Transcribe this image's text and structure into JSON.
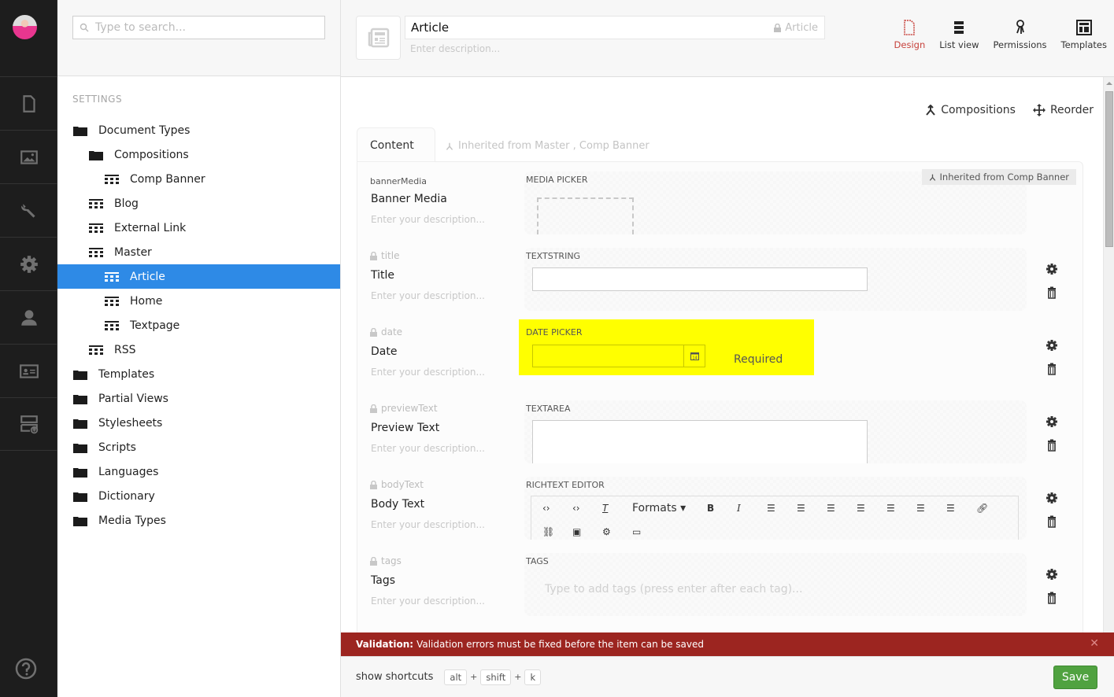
{
  "nav": {
    "sections": [
      "content",
      "media",
      "settings",
      "developer",
      "users",
      "members",
      "forms"
    ],
    "help_icon": "question-circle-icon"
  },
  "tree": {
    "search_placeholder": "Type to search...",
    "section_title": "SETTINGS",
    "nodes": [
      {
        "label": "Document Types",
        "icon": "folder-icon",
        "level": 0
      },
      {
        "label": "Compositions",
        "icon": "folder-icon",
        "level": 1
      },
      {
        "label": "Comp Banner",
        "icon": "doctype-icon",
        "level": 2
      },
      {
        "label": "Blog",
        "icon": "doctype-icon",
        "level": 1
      },
      {
        "label": "External Link",
        "icon": "doctype-icon",
        "level": 1
      },
      {
        "label": "Master",
        "icon": "doctype-icon",
        "level": 1
      },
      {
        "label": "Article",
        "icon": "doctype-icon",
        "level": 2,
        "selected": true
      },
      {
        "label": "Home",
        "icon": "doctype-icon",
        "level": 2
      },
      {
        "label": "Textpage",
        "icon": "doctype-icon",
        "level": 2
      },
      {
        "label": "RSS",
        "icon": "doctype-icon",
        "level": 1
      },
      {
        "label": "Templates",
        "icon": "folder-icon",
        "level": 0
      },
      {
        "label": "Partial Views",
        "icon": "folder-icon",
        "level": 0
      },
      {
        "label": "Stylesheets",
        "icon": "folder-icon",
        "level": 0
      },
      {
        "label": "Scripts",
        "icon": "folder-icon",
        "level": 0
      },
      {
        "label": "Languages",
        "icon": "folder-icon",
        "level": 0
      },
      {
        "label": "Dictionary",
        "icon": "folder-icon",
        "level": 0
      },
      {
        "label": "Media Types",
        "icon": "folder-icon",
        "level": 0
      }
    ]
  },
  "header": {
    "name_value": "Article",
    "alias": "Article",
    "description_placeholder": "Enter description...",
    "apps": [
      {
        "label": "Design",
        "active": true
      },
      {
        "label": "List view"
      },
      {
        "label": "Permissions"
      },
      {
        "label": "Templates"
      }
    ]
  },
  "toolbar": {
    "compositions": "Compositions",
    "reorder": "Reorder"
  },
  "tabs": {
    "content": "Content",
    "inherited": "Inherited from Master , Comp Banner"
  },
  "properties": [
    {
      "alias": "bannerMedia",
      "label": "Banner Media",
      "description": "Enter your description...",
      "editor": "MEDIA PICKER",
      "inherited": "Inherited from Comp Banner",
      "locked": false
    },
    {
      "alias": "title",
      "label": "Title",
      "description": "Enter your description...",
      "editor": "TEXTSTRING",
      "locked": true
    },
    {
      "alias": "date",
      "label": "Date",
      "description": "Enter your description...",
      "editor": "DATE PICKER",
      "locked": true,
      "validation": "Required"
    },
    {
      "alias": "previewText",
      "label": "Preview Text",
      "description": "Enter your description...",
      "editor": "TEXTAREA",
      "locked": true
    },
    {
      "alias": "bodyText",
      "label": "Body Text",
      "description": "Enter your description...",
      "editor": "RICHTEXT EDITOR",
      "locked": true
    },
    {
      "alias": "tags",
      "label": "Tags",
      "description": "Enter your description...",
      "editor": "TAGS",
      "locked": true,
      "placeholder": "Type to add tags (press enter after each tag)..."
    }
  ],
  "rte": {
    "formats_label": "Formats"
  },
  "validation": {
    "title": "Validation:",
    "message": "Validation errors must be fixed before the item can be saved"
  },
  "footer": {
    "shortcuts_label": "show shortcuts",
    "keys": [
      "alt",
      "shift",
      "k"
    ],
    "save_label": "Save"
  },
  "colors": {
    "selected": "#2e8ae6",
    "active_app": "#c7433d",
    "error": "#9c2520",
    "save": "#50a240",
    "highlight": "#ffff00"
  }
}
